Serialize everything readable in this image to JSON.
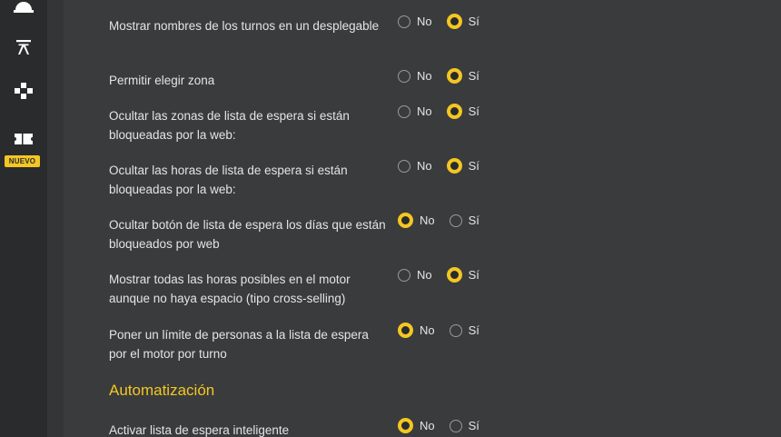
{
  "sidebar": {
    "items": [
      {
        "icon": "cloche-icon"
      },
      {
        "icon": "torii-gate-icon"
      },
      {
        "icon": "puzzle-icon"
      },
      {
        "icon": "ticket-icon",
        "badge": "NUEVO"
      }
    ]
  },
  "options": {
    "no": "No",
    "yes": "Sí"
  },
  "settings": [
    {
      "label": "Mostrar nombres de los turnos en un desplegable",
      "selected": "yes"
    },
    {
      "label": "Permitir elegir zona",
      "selected": "yes"
    },
    {
      "label": "Ocultar las zonas de lista de espera si están bloqueadas por la web:",
      "selected": "yes"
    },
    {
      "label": "Ocultar las horas de lista de espera si están bloqueadas por la web:",
      "selected": "yes"
    },
    {
      "label": "Ocultar botón de lista de espera los días que están bloqueados por web",
      "selected": "no"
    },
    {
      "label": "Mostrar todas las horas posibles en el motor aunque no haya espacio (tipo cross-selling)",
      "selected": "yes"
    },
    {
      "label": "Poner un límite de personas a la lista de espera por el motor por turno",
      "selected": "no"
    }
  ],
  "automation": {
    "title": "Automatización",
    "settings": [
      {
        "label": "Activar lista de espera inteligente",
        "selected": "no"
      }
    ]
  },
  "colors": {
    "accent": "#f3c623",
    "sidebar": "#2a2b2c",
    "background": "#3a3b3c"
  }
}
